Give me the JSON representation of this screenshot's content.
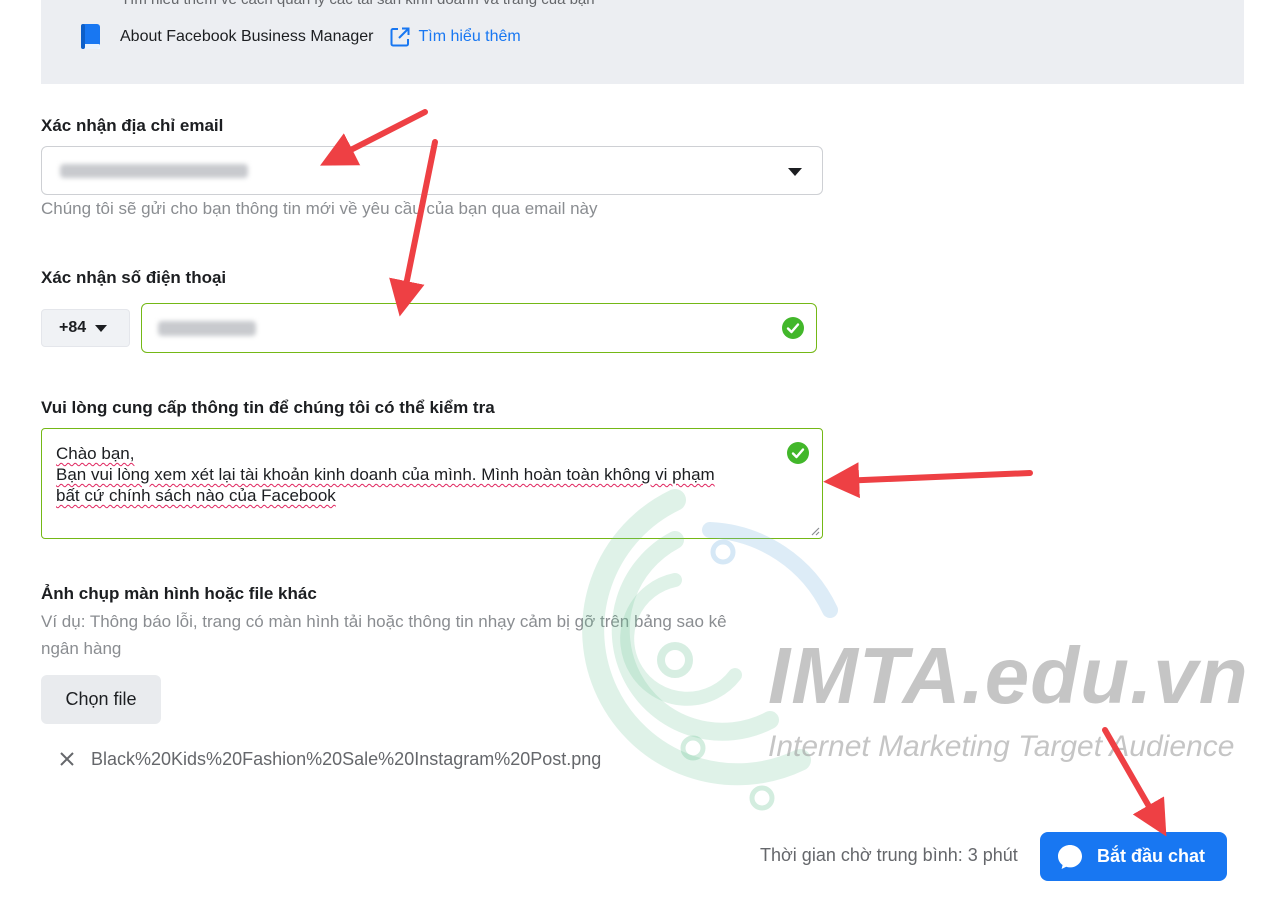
{
  "top_panel": {
    "cut_text": "Tìm hiểu thêm về cách quản lý các tài sản kinh doanh và trang của bạn",
    "about_label": "About Facebook Business Manager",
    "learn_more": "Tìm hiểu thêm"
  },
  "email": {
    "label": "Xác nhận địa chỉ email",
    "hint": "Chúng tôi sẽ gửi cho bạn thông tin mới về yêu cầu của bạn qua email này"
  },
  "phone": {
    "label": "Xác nhận số điện thoại",
    "country_code": "+84"
  },
  "details": {
    "label": "Vui lòng cung cấp thông tin để chúng tôi có thể kiểm tra",
    "lines": [
      "Chào bạn,",
      "Bạn vui lòng xem xét lại tài khoản kinh doanh của mình. Mình hoàn toàn không vi phạm",
      "bất cứ chính sách nào của Facebook"
    ]
  },
  "attachment": {
    "label": "Ảnh chụp màn hình hoặc file khác",
    "hint_line1": "Ví dụ: Thông báo lỗi, trang có màn hình tải hoặc thông tin nhạy cảm bị gỡ trên bảng sao kê",
    "hint_line2": "ngân hàng",
    "choose_file": "Chọn file",
    "file_name": "Black%20Kids%20Fashion%20Sale%20Instagram%20Post.png"
  },
  "footer": {
    "wait_text": "Thời gian chờ trung bình: 3 phút",
    "start_chat": "Bắt đầu chat"
  },
  "watermark": {
    "title": "IMTA.edu.vn",
    "subtitle": "Internet Marketing Target Audience"
  },
  "colors": {
    "accent": "#1877f2",
    "valid_border": "#74b816",
    "check_green": "#42b72a",
    "annotation_arrow": "#ee4044"
  }
}
